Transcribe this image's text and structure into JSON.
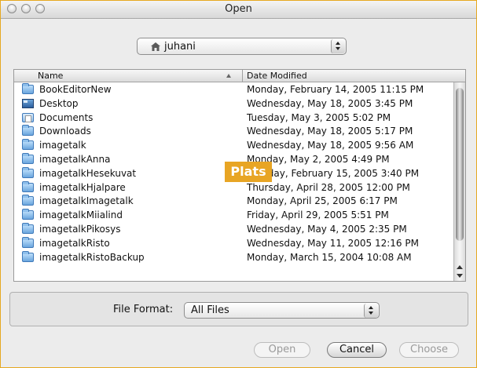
{
  "window": {
    "title": "Open"
  },
  "location": {
    "label": "juhani",
    "icon": "home-icon"
  },
  "columns": {
    "name": "Name",
    "date": "Date Modified"
  },
  "files": [
    {
      "name": "BookEditorNew",
      "date": "Monday, February 14, 2005 11:15 PM",
      "icon": "folder-icon"
    },
    {
      "name": "Desktop",
      "date": "Wednesday, May 18, 2005 3:45 PM",
      "icon": "desktop-icon"
    },
    {
      "name": "Documents",
      "date": "Tuesday, May 3, 2005 5:02 PM",
      "icon": "documents-folder-icon"
    },
    {
      "name": "Downloads",
      "date": "Wednesday, May 18, 2005 5:17 PM",
      "icon": "folder-icon"
    },
    {
      "name": "imagetalk",
      "date": "Wednesday, May 18, 2005 9:56 AM",
      "icon": "folder-icon"
    },
    {
      "name": "imagetalkAnna",
      "date": "Monday, May 2, 2005 4:49 PM",
      "icon": "folder-icon"
    },
    {
      "name": "imagetalkHesekuvat",
      "date": "Tuesday, February 15, 2005 3:40 PM",
      "icon": "folder-icon"
    },
    {
      "name": "imagetalkHjalpare",
      "date": "Thursday, April 28, 2005 12:00 PM",
      "icon": "folder-icon"
    },
    {
      "name": "imagetalkImagetalk",
      "date": "Monday, April 25, 2005 6:17 PM",
      "icon": "folder-icon"
    },
    {
      "name": "imagetalkMiialind",
      "date": "Friday, April 29, 2005 5:51 PM",
      "icon": "folder-icon"
    },
    {
      "name": "imagetalkPikosys",
      "date": "Wednesday, May 4, 2005 2:35 PM",
      "icon": "folder-icon"
    },
    {
      "name": "imagetalkRisto",
      "date": "Wednesday, May 11, 2005 12:16 PM",
      "icon": "folder-icon"
    },
    {
      "name": "imagetalkRistoBackup",
      "date": "Monday, March 15, 2004 10:08 AM",
      "icon": "folder-icon"
    }
  ],
  "overlay": {
    "label": "Plats"
  },
  "format": {
    "label": "File Format:",
    "value": "All Files"
  },
  "buttons": {
    "open": "Open",
    "cancel": "Cancel",
    "choose": "Choose"
  },
  "colors": {
    "accent_border": "#e6a820",
    "overlay_bg": "#e8a524"
  }
}
